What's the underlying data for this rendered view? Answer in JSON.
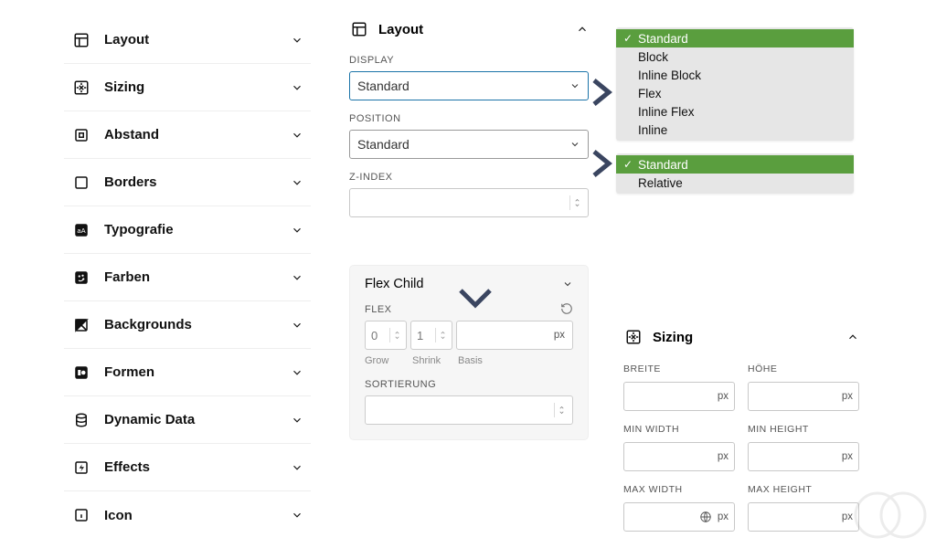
{
  "sidebar": {
    "items": [
      {
        "label": "Layout",
        "icon": "layout-icon"
      },
      {
        "label": "Sizing",
        "icon": "sizing-icon"
      },
      {
        "label": "Abstand",
        "icon": "spacing-icon"
      },
      {
        "label": "Borders",
        "icon": "borders-icon"
      },
      {
        "label": "Typografie",
        "icon": "typography-icon"
      },
      {
        "label": "Farben",
        "icon": "palette-icon"
      },
      {
        "label": "Backgrounds",
        "icon": "background-icon"
      },
      {
        "label": "Formen",
        "icon": "shapes-icon"
      },
      {
        "label": "Dynamic Data",
        "icon": "database-icon"
      },
      {
        "label": "Effects",
        "icon": "effects-icon"
      },
      {
        "label": "Icon",
        "icon": "info-icon"
      }
    ]
  },
  "layout_panel": {
    "title": "Layout",
    "display_label": "DISPLAY",
    "display_value": "Standard",
    "position_label": "POSITION",
    "position_value": "Standard",
    "zindex_label": "Z-INDEX",
    "zindex_value": ""
  },
  "display_dropdown": {
    "selected": "Standard",
    "options": [
      "Standard",
      "Block",
      "Inline Block",
      "Flex",
      "Inline Flex",
      "Inline"
    ]
  },
  "position_dropdown": {
    "selected": "Standard",
    "options": [
      "Standard",
      "Relative"
    ]
  },
  "flex_child": {
    "title": "Flex Child",
    "flex_label": "FLEX",
    "grow_value": "0",
    "grow_label": "Grow",
    "shrink_value": "1",
    "shrink_label": "Shrink",
    "basis_value": "",
    "basis_unit": "px",
    "basis_label": "Basis",
    "sort_label": "SORTIERUNG",
    "sort_value": ""
  },
  "sizing_panel": {
    "title": "Sizing",
    "fields": {
      "breite": {
        "label": "BREITE",
        "unit": "px"
      },
      "hoehe": {
        "label": "HÖHE",
        "unit": "px"
      },
      "minwidth": {
        "label": "MIN WIDTH",
        "unit": "px"
      },
      "minheight": {
        "label": "MIN HEIGHT",
        "unit": "px"
      },
      "maxwidth": {
        "label": "MAX WIDTH",
        "unit": "px",
        "globe": true
      },
      "maxheight": {
        "label": "MAX HEIGHT",
        "unit": "px"
      }
    }
  }
}
